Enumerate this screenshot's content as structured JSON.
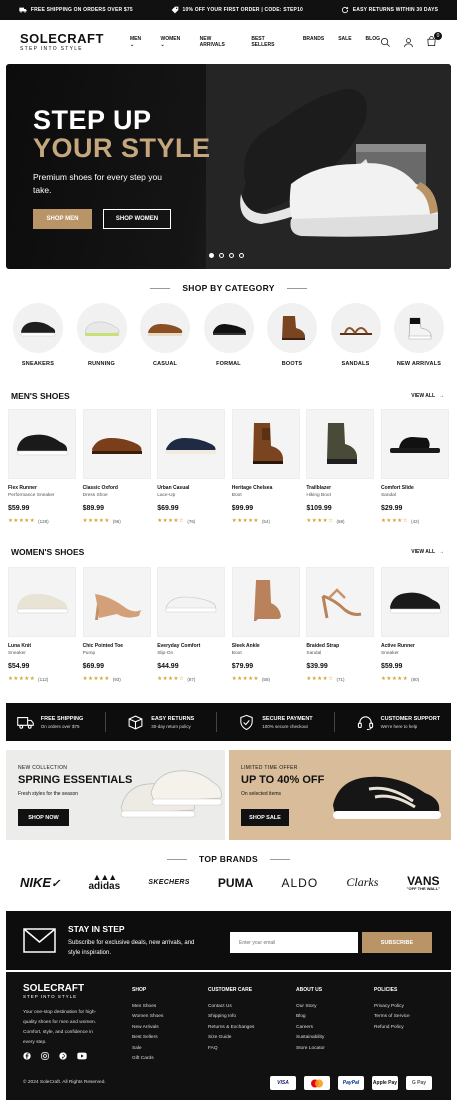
{
  "topbar": {
    "shipping": "FREE SHIPPING ON ORDERS OVER $75",
    "promo": "10% OFF YOUR FIRST ORDER | CODE: STEP10",
    "returns": "EASY RETURNS WITHIN 30 DAYS"
  },
  "header": {
    "logo": "SOLECRAFT",
    "tagline": "STEP INTO STYLE",
    "nav": [
      "MEN",
      "WOMEN",
      "NEW ARRIVALS",
      "BEST SELLERS",
      "BRANDS",
      "SALE",
      "BLOG"
    ],
    "cart_count": "0"
  },
  "hero": {
    "line1": "STEP UP",
    "line2": "YOUR STYLE",
    "subtitle": "Premium shoes for every step you take.",
    "btn_men": "SHOP MEN",
    "btn_women": "SHOP WOMEN"
  },
  "categories": {
    "title": "SHOP BY CATEGORY",
    "items": [
      "SNEAKERS",
      "RUNNING",
      "CASUAL",
      "FORMAL",
      "BOOTS",
      "SANDALS",
      "NEW ARRIVALS"
    ]
  },
  "mens": {
    "title": "MEN'S SHOES",
    "view_all": "VIEW ALL",
    "products": [
      {
        "name": "Flex Runner",
        "type": "Performance Sneaker",
        "price": "$59.99",
        "reviews": "(128)"
      },
      {
        "name": "Classic Oxford",
        "type": "Dress Shoe",
        "price": "$89.99",
        "reviews": "(96)"
      },
      {
        "name": "Urban Casual",
        "type": "Lace-Up",
        "price": "$69.99",
        "reviews": "(76)"
      },
      {
        "name": "Heritage Chelsea",
        "type": "Boot",
        "price": "$99.99",
        "reviews": "(54)"
      },
      {
        "name": "Trailblazer",
        "type": "Hiking Boot",
        "price": "$109.99",
        "reviews": "(68)"
      },
      {
        "name": "Comfort Slide",
        "type": "Sandal",
        "price": "$29.99",
        "reviews": "(42)"
      }
    ]
  },
  "womens": {
    "title": "WOMEN'S SHOES",
    "view_all": "VIEW ALL",
    "products": [
      {
        "name": "Luna Knit",
        "type": "Sneaker",
        "price": "$54.99",
        "reviews": "(112)"
      },
      {
        "name": "Chic Pointed Toe",
        "type": "Pump",
        "price": "$69.99",
        "reviews": "(93)"
      },
      {
        "name": "Everyday Comfort",
        "type": "Slip-On",
        "price": "$44.99",
        "reviews": "(87)"
      },
      {
        "name": "Sleek Ankle",
        "type": "Boot",
        "price": "$79.99",
        "reviews": "(58)"
      },
      {
        "name": "Braided Strap",
        "type": "Sandal",
        "price": "$39.99",
        "reviews": "(71)"
      },
      {
        "name": "Active Runner",
        "type": "Sneaker",
        "price": "$59.99",
        "reviews": "(80)"
      }
    ]
  },
  "features": [
    {
      "title": "FREE SHIPPING",
      "sub": "On orders over $75"
    },
    {
      "title": "EASY RETURNS",
      "sub": "30-day return policy"
    },
    {
      "title": "SECURE PAYMENT",
      "sub": "100% secure checkout"
    },
    {
      "title": "CUSTOMER SUPPORT",
      "sub": "We're here to help"
    }
  ],
  "promo1": {
    "kicker": "NEW COLLECTION",
    "title": "SPRING ESSENTIALS",
    "desc": "Fresh styles for the season",
    "button": "SHOP NOW"
  },
  "promo2": {
    "kicker": "LIMITED TIME OFFER",
    "title": "UP TO 40% OFF",
    "desc": "On selected items",
    "button": "SHOP SALE"
  },
  "brands": {
    "title": "TOP BRANDS",
    "items": [
      "NIKE",
      "adidas",
      "SKECHERS",
      "PUMA",
      "ALDO",
      "Clarks",
      "VANS"
    ],
    "vans_sub": "\"OFF THE WALL\""
  },
  "newsletter": {
    "title": "STAY IN STEP",
    "desc": "Subscribe for exclusive deals, new arrivals, and style inspiration.",
    "placeholder": "Enter your email",
    "button": "SUBSCRIBE"
  },
  "footer": {
    "logo": "SOLECRAFT",
    "tagline": "STEP INTO STYLE",
    "about": "Your one-stop destination for high-quality shoes for men and women. Comfort, style, and confidence in every step.",
    "shop": {
      "title": "SHOP",
      "links": [
        "Men Shoes",
        "Women Shoes",
        "New Arrivals",
        "Best Sellers",
        "Sale",
        "Gift Cards"
      ]
    },
    "care": {
      "title": "CUSTOMER CARE",
      "links": [
        "Contact Us",
        "Shipping Info",
        "Returns & Exchanges",
        "Size Guide",
        "FAQ"
      ]
    },
    "aboutus": {
      "title": "ABOUT US",
      "links": [
        "Our Story",
        "Blog",
        "Careers",
        "Sustainability",
        "Store Locator"
      ]
    },
    "policies": {
      "title": "POLICIES",
      "links": [
        "Privacy Policy",
        "Terms of Service",
        "Refund Policy"
      ]
    },
    "copyright": "© 2024 SoleCraft. All Rights Reserved.",
    "payments": [
      "VISA",
      "mastercard",
      "PayPal",
      "Apple Pay",
      "G Pay"
    ]
  },
  "colors": {
    "accent": "#b89466",
    "dark": "#111111",
    "star": "#d4a535"
  }
}
